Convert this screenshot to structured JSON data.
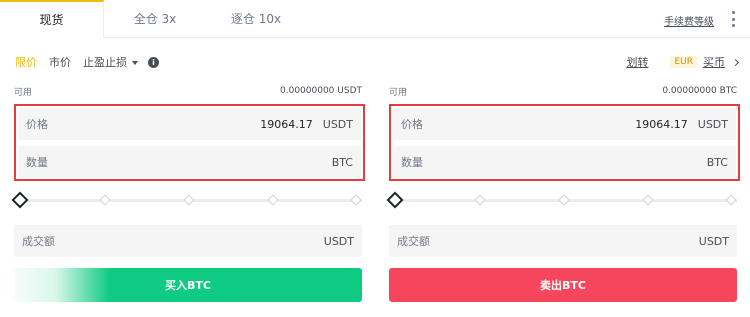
{
  "tabs": [
    {
      "label": "现货"
    },
    {
      "label": "全仓 3x"
    },
    {
      "label": "逐仓 10x"
    }
  ],
  "fee_level_link": "手续费等级",
  "order_types": {
    "limit": "限价",
    "market": "市价",
    "stop_limit": "止盈止损",
    "info_glyph": "i"
  },
  "right_links": {
    "transfer": "划转",
    "currency_badge": "EUR",
    "buy_crypto": "买币"
  },
  "buy_panel": {
    "available_label": "可用",
    "available_value": "0.00000000 USDT",
    "price_label": "价格",
    "price_value": "19064.17",
    "price_unit": "USDT",
    "amount_label": "数量",
    "amount_unit": "BTC",
    "total_label": "成交额",
    "total_unit": "USDT",
    "button_label": "买入BTC"
  },
  "sell_panel": {
    "available_label": "可用",
    "available_value": "0.00000000 BTC",
    "price_label": "价格",
    "price_value": "19064.17",
    "price_unit": "USDT",
    "amount_label": "数量",
    "amount_unit": "BTC",
    "total_label": "成交额",
    "total_unit": "USDT",
    "button_label": "卖出BTC"
  },
  "colors": {
    "accent": "#f0b90b",
    "buy": "#0ecb81",
    "sell": "#f6465d",
    "highlight": "#e43d3f"
  },
  "icons": {
    "more": "vertical-dots-icon",
    "info": "info-icon",
    "chevron": "chevron-right-icon",
    "dropdown": "caret-down-icon"
  }
}
